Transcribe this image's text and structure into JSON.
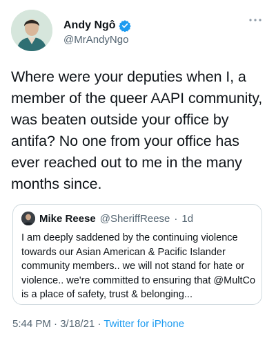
{
  "author": {
    "display_name": "Andy Ngô",
    "handle": "@MrAndyNgo",
    "avatar_icon": "profile-photo",
    "verified_icon": "verified-badge-icon"
  },
  "more_icon": "more-options-icon",
  "tweet": {
    "text": "Where were your deputies when I, a member of the queer AAPI community, was beaten outside your office by antifa? No one from your office has ever reached out to me in the many months since."
  },
  "quoted_tweet": {
    "display_name": "Mike Reese",
    "handle": "@SheriffReese",
    "separator": "·",
    "time": "1d",
    "text": "I am deeply saddened by the continuing violence towards our Asian American & Pacific Islander community members.. we will not stand for hate or violence.. we're committed to ensuring that @MultCo is a place of safety, trust & belonging..."
  },
  "meta": {
    "time": "5:44 PM",
    "sep1": "·",
    "date": "3/18/21",
    "sep2": "·",
    "source": "Twitter for iPhone"
  },
  "colors": {
    "link": "#1d9bf0",
    "secondary_text": "#536471",
    "border": "#cfd9de"
  }
}
